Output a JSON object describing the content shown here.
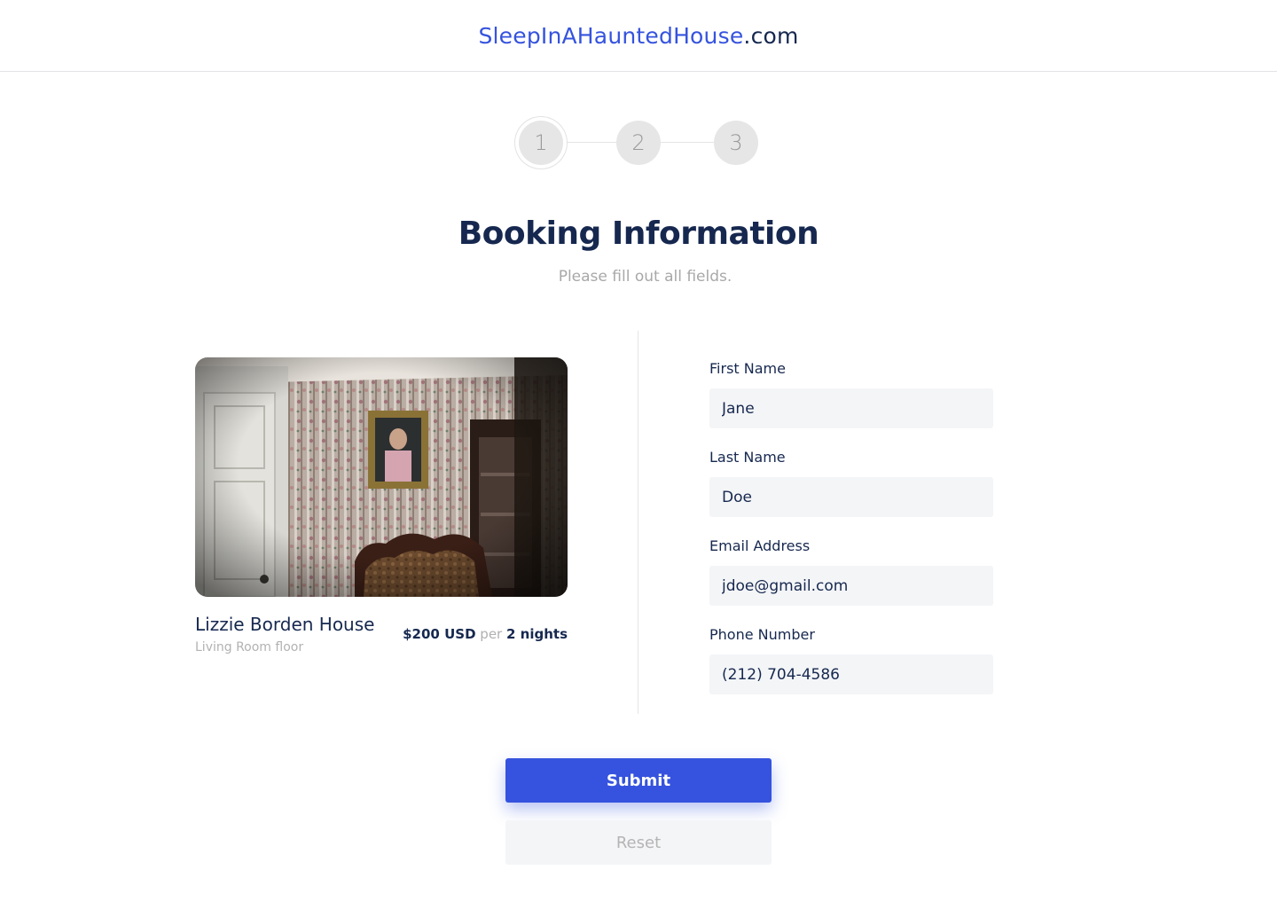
{
  "header": {
    "brand": "SleepInAHauntedHouse",
    "tld": ".com"
  },
  "stepper": {
    "steps": [
      "1",
      "2",
      "3"
    ],
    "current": 1
  },
  "page": {
    "title": "Booking Information",
    "subtitle": "Please fill out all fields."
  },
  "listing": {
    "name": "Lizzie Borden House",
    "room": "Living Room floor",
    "price": "$200 USD",
    "per": "per",
    "duration": "2 nights"
  },
  "form": {
    "first_name": {
      "label": "First Name",
      "value": "Jane"
    },
    "last_name": {
      "label": "Last Name",
      "value": "Doe"
    },
    "email": {
      "label": "Email Address",
      "value": "jdoe@gmail.com"
    },
    "phone": {
      "label": "Phone Number",
      "value": "(212) 704-4586"
    }
  },
  "buttons": {
    "submit": "Submit",
    "reset": "Reset"
  },
  "colors": {
    "accent": "#3553de",
    "navy": "#16284f",
    "muted": "#a8a8a8",
    "field_bg": "#f4f5f7"
  }
}
